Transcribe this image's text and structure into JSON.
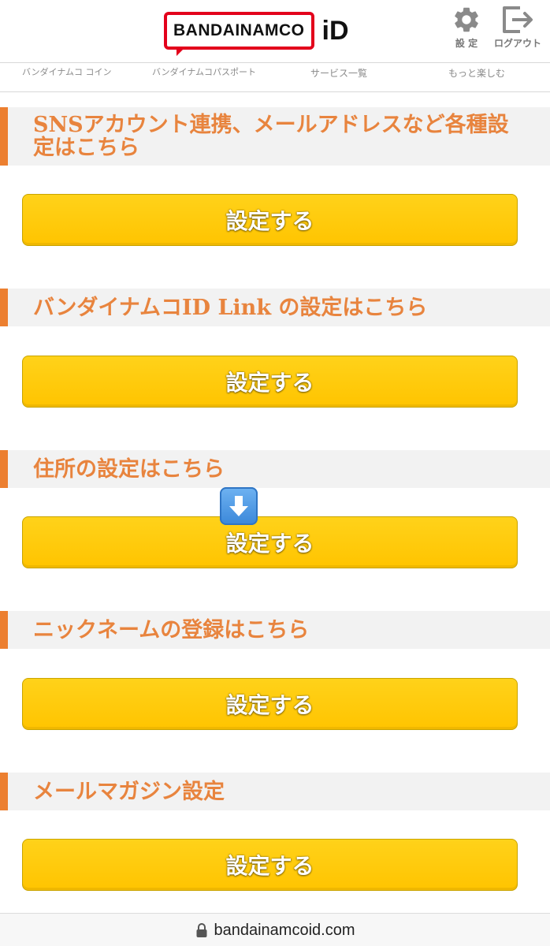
{
  "header": {
    "logo_text": "BANDAINAMCO",
    "logo_id": "iD",
    "settings_label": "設 定",
    "logout_label": "ログアウト"
  },
  "nav": {
    "items": [
      {
        "label": "バンダイナムコ コイン"
      },
      {
        "label": "バンダイナムコパスポート"
      },
      {
        "label": "サービス一覧"
      },
      {
        "label": "もっと楽しむ"
      }
    ]
  },
  "sections": [
    {
      "title": "SNSアカウント連携、メールアドレスなど各種設定はこちら",
      "button_label": "設定する"
    },
    {
      "title": "バンダイナムコID Link の設定はこちら",
      "button_label": "設定する"
    },
    {
      "title": "住所の設定はこちら",
      "button_label": "設定する"
    },
    {
      "title": "ニックネームの登録はこちら",
      "button_label": "設定する"
    },
    {
      "title": "メールマガジン設定",
      "button_label": "設定する"
    }
  ],
  "url_bar": {
    "url": "bandainamcoid.com"
  },
  "colors": {
    "accent_orange": "#ec7f30",
    "title_orange": "#e8843e",
    "button_yellow": "#ffc400",
    "logo_red": "#e3001b"
  },
  "icons": {
    "settings": "gear-icon",
    "logout": "logout-icon",
    "arrow": "down-arrow-icon",
    "lock": "lock-icon"
  }
}
